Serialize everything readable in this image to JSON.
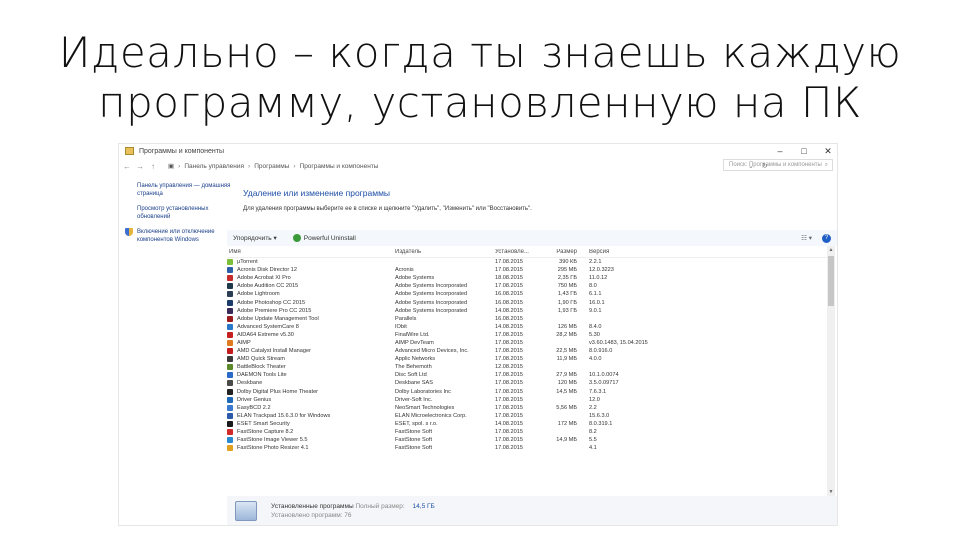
{
  "slide": {
    "title_line1": "Идеально – когда ты знаешь каждую",
    "title_line2": "программу, установленную на ПК"
  },
  "window": {
    "title": "Программы и компоненты",
    "controls": [
      "–",
      "□",
      "✕"
    ],
    "breadcrumb": [
      "Панель управления",
      "Программы",
      "Программы и компоненты"
    ],
    "search_placeholder": "Поиск: Программы и компоненты"
  },
  "sidebar": {
    "items": [
      {
        "label": "Панель управления — домашняя страница",
        "shield": false
      },
      {
        "label": "Просмотр установленных обновлений",
        "shield": false
      },
      {
        "label": "Включение или отключение компонентов Windows",
        "shield": true
      }
    ]
  },
  "main": {
    "heading": "Удаление или изменение программы",
    "description": "Для удаления программы выберите ее в списке и щелкните \"Удалить\", \"Изменить\" или \"Восстановить\"."
  },
  "toolbar": {
    "organize": "Упорядочить ▾",
    "uninstall": "Powerful Uninstall",
    "help": "?"
  },
  "table": {
    "headers": [
      "Имя",
      "Издатель",
      "Установле...",
      "Размер",
      "Версия"
    ],
    "rows": [
      {
        "name": "µTorrent",
        "publisher": "",
        "date": "17.08.2015",
        "size": "390 КБ",
        "version": "2.2.1",
        "color": "#7bbf3a"
      },
      {
        "name": "Acronis Disk Director 12",
        "publisher": "Acronis",
        "date": "17.08.2015",
        "size": "295 МБ",
        "version": "12.0.3223",
        "color": "#2c5fa8"
      },
      {
        "name": "Adobe Acrobat XI Pro",
        "publisher": "Adobe Systems",
        "date": "18.08.2015",
        "size": "2,35 ГБ",
        "version": "11.0.12",
        "color": "#c62b2b"
      },
      {
        "name": "Adobe Audition CC 2015",
        "publisher": "Adobe Systems Incorporated",
        "date": "17.08.2015",
        "size": "750 МБ",
        "version": "8.0",
        "color": "#1e3a4a"
      },
      {
        "name": "Adobe Lightroom",
        "publisher": "Adobe Systems Incorporated",
        "date": "16.08.2015",
        "size": "1,43 ГБ",
        "version": "6.1.1",
        "color": "#2a3d55"
      },
      {
        "name": "Adobe Photoshop CC 2015",
        "publisher": "Adobe Systems Incorporated",
        "date": "16.08.2015",
        "size": "1,90 ГБ",
        "version": "16.0.1",
        "color": "#1b3b6a"
      },
      {
        "name": "Adobe Premiere Pro CC 2015",
        "publisher": "Adobe Systems Incorporated",
        "date": "14.08.2015",
        "size": "1,93 ГБ",
        "version": "9.0.1",
        "color": "#3a2a5a"
      },
      {
        "name": "Adobe Update Management Tool",
        "publisher": "Parallels",
        "date": "16.08.2015",
        "size": "",
        "version": "",
        "color": "#9b1c1c"
      },
      {
        "name": "Advanced SystemCare 8",
        "publisher": "IObit",
        "date": "14.08.2015",
        "size": "126 МБ",
        "version": "8.4.0",
        "color": "#2a78c8"
      },
      {
        "name": "AIDA64 Extreme v5.30",
        "publisher": "FinalWire Ltd.",
        "date": "17.08.2015",
        "size": "28,2 МБ",
        "version": "5.30",
        "color": "#c42020"
      },
      {
        "name": "AIMP",
        "publisher": "AIMP DevTeam",
        "date": "17.08.2015",
        "size": "",
        "version": "v3.60.1483, 15.04.2015",
        "color": "#e07a1e"
      },
      {
        "name": "AMD Catalyst Install Manager",
        "publisher": "Advanced Micro Devices, Inc.",
        "date": "17.08.2015",
        "size": "22,5 МБ",
        "version": "8.0.916.0",
        "color": "#c21d1d"
      },
      {
        "name": "AMD Quick Stream",
        "publisher": "Applic Networks",
        "date": "17.08.2015",
        "size": "11,9 МБ",
        "version": "4.0.0",
        "color": "#3a3a3a"
      },
      {
        "name": "BattleBlock Theater",
        "publisher": "The Behemoth",
        "date": "12.08.2015",
        "size": "",
        "version": "",
        "color": "#5a8a2a"
      },
      {
        "name": "DAEMON Tools Lite",
        "publisher": "Disc Soft Ltd",
        "date": "17.08.2015",
        "size": "27,9 МБ",
        "version": "10.1.0.0074",
        "color": "#2a6ac8"
      },
      {
        "name": "Deskbane",
        "publisher": "Deskbane SAS",
        "date": "17.08.2015",
        "size": "120 МБ",
        "version": "3.5.0.09717",
        "color": "#4a4a4a"
      },
      {
        "name": "Dolby Digital Plus Home Theater",
        "publisher": "Dolby Laboratories Inc",
        "date": "17.08.2015",
        "size": "14,5 МБ",
        "version": "7.6.3.1",
        "color": "#222222"
      },
      {
        "name": "Driver Genius",
        "publisher": "Driver-Soft Inc.",
        "date": "17.08.2015",
        "size": "",
        "version": "12.0",
        "color": "#1e6ab8"
      },
      {
        "name": "EasyBCD 2.2",
        "publisher": "NeoSmart Technologies",
        "date": "17.08.2015",
        "size": "5,56 МБ",
        "version": "2.2",
        "color": "#3b7ad0"
      },
      {
        "name": "ELAN Trackpad 15.6.3.0 for Windows",
        "publisher": "ELAN Microelectronics Corp.",
        "date": "17.08.2015",
        "size": "",
        "version": "15.6.3.0",
        "color": "#2a5aa8"
      },
      {
        "name": "ESET Smart Security",
        "publisher": "ESET, spol. s r.o.",
        "date": "14.08.2015",
        "size": "172 МБ",
        "version": "8.0.319.1",
        "color": "#1a1a1a"
      },
      {
        "name": "FastStone Capture 8.2",
        "publisher": "FastStone Soft",
        "date": "17.08.2015",
        "size": "",
        "version": "8.2",
        "color": "#d02a2a"
      },
      {
        "name": "FastStone Image Viewer 5.5",
        "publisher": "FastStone Soft",
        "date": "17.08.2015",
        "size": "14,9 МБ",
        "version": "5.5",
        "color": "#2a8ad0"
      },
      {
        "name": "FastStone Photo Resizer 4.1",
        "publisher": "FastStone Soft",
        "date": "17.08.2015",
        "size": "",
        "version": "4.1",
        "color": "#e0a020"
      }
    ]
  },
  "footer": {
    "title": "Установленные программы",
    "size_label": "Полный размер:",
    "size_value": "14,5 ГБ",
    "count": "Установлено программ: 76"
  }
}
